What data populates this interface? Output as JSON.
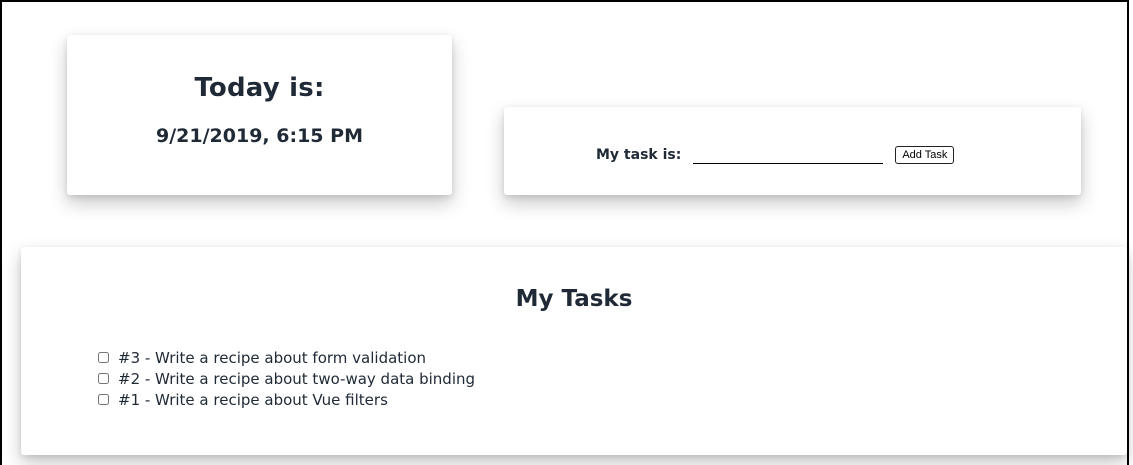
{
  "date_card": {
    "title": "Today is:",
    "value": "9/21/2019, 6:15 PM"
  },
  "task_form": {
    "label": "My task is:",
    "input_value": "",
    "button_label": "Add Task"
  },
  "task_list": {
    "title": "My Tasks",
    "items": [
      {
        "text": "#3 - Write a recipe about form validation",
        "checked": false
      },
      {
        "text": "#2 - Write a recipe about two-way data binding",
        "checked": false
      },
      {
        "text": "#1 - Write a recipe about Vue filters",
        "checked": false
      }
    ]
  }
}
